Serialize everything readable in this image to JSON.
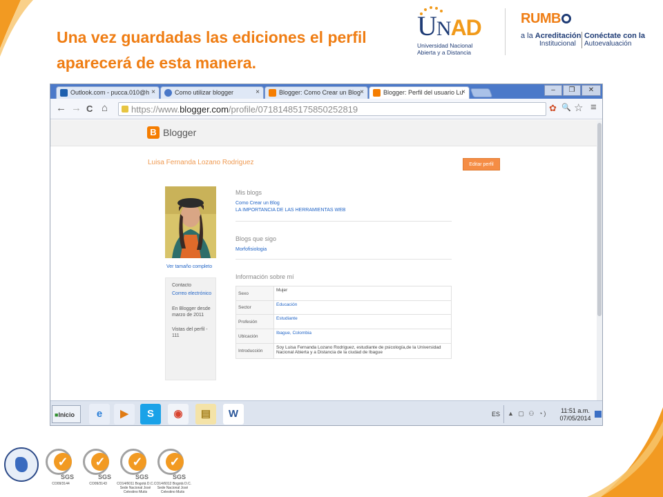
{
  "slide": {
    "title": "Una vez guardadas las ediciones el perfil aparecerá de esta manera."
  },
  "logos": {
    "unad_word_u": "U",
    "unad_word_n": "N",
    "unad_word_ad": "AD",
    "unad_sub1": "Universidad Nacional",
    "unad_sub2": "Abierta y a Distancia",
    "rumbo_word": "RUMB",
    "rumbo_sub1_a": "a la ",
    "rumbo_sub1_b": "Acreditación",
    "rumbo_sub2": "Institucional",
    "rumbo_c1": "Conéctate con la",
    "rumbo_c2": "Autoevaluación"
  },
  "browser": {
    "tabs": [
      {
        "label": "Outlook.com - pucca.010@h",
        "icon_color": "#1d5fae"
      },
      {
        "label": "Como utilizar blogger",
        "icon_color": "#4a78c8"
      },
      {
        "label": "Blogger: Como Crear un Blog",
        "icon_color": "#f57d00"
      },
      {
        "label": "Blogger: Perfil del usuario Lu",
        "icon_color": "#f57d00"
      }
    ],
    "tab_close": "×",
    "window_controls": {
      "minimize": "–",
      "maximize": "❐",
      "close": "✕"
    },
    "url_prefix": "https://www.",
    "url_domain": "blogger.com",
    "url_path": "/profile/07181485175850252819",
    "nav": {
      "back": "←",
      "forward": "→",
      "reload": "C",
      "home": "⌂"
    },
    "tools": {
      "extension": "✿",
      "zoom": "🔍",
      "star": "☆",
      "menu": "≡"
    }
  },
  "blogger": {
    "logo_letter": "B",
    "brand": "Blogger",
    "profile_name": "Luisa Fernanda Lozano Rodriguez",
    "edit_button": "Editar perfil",
    "full_size_link": "Ver tamaño completo",
    "sidebar": {
      "contact_label": "Contacto",
      "email_link": "Correo electrónico",
      "since_1": "En Blogger desde",
      "since_2": "marzo de 2011",
      "views_1": "Vistas del perfil -",
      "views_2": "111"
    },
    "my_blogs_title": "Mis blogs",
    "my_blogs": [
      "Como Crear un Blog",
      "LA IMPORTANCIA DE LAS HERRAMIENTAS WEB"
    ],
    "following_title": "Blogs que sigo",
    "following": [
      "Morfofisiologia"
    ],
    "about_title": "Información sobre mí",
    "about": [
      {
        "key": "Sexo",
        "value": "Mujer",
        "link": false
      },
      {
        "key": "Sector",
        "value": "Educación",
        "link": true
      },
      {
        "key": "Profesión",
        "value": "Estudiante",
        "link": true
      },
      {
        "key": "Ubicación",
        "value": "Ibague, Colombia",
        "link": true
      },
      {
        "key": "Introducción",
        "value": "Soy Luisa Fernanda Lozano Rodriguez, estudiante de psicología,de la Universidad Nacional Abierta y a Distancia de la ciudad de Ibague",
        "link": false
      }
    ]
  },
  "taskbar": {
    "start_label": "Inicio",
    "apps": [
      {
        "name": "ie",
        "glyph": "e",
        "bg": "#e9eef7",
        "color": "#2b7fd8"
      },
      {
        "name": "media",
        "glyph": "▶",
        "bg": "#e9eef7",
        "color": "#e07b13"
      },
      {
        "name": "skype",
        "glyph": "S",
        "bg": "#1aa2e8",
        "color": "#ffffff"
      },
      {
        "name": "chrome",
        "glyph": "◉",
        "bg": "#f1f4f9",
        "color": "#d8442f"
      },
      {
        "name": "explorer",
        "glyph": "▤",
        "bg": "#f4e3a8",
        "color": "#a37e1b"
      },
      {
        "name": "word",
        "glyph": "W",
        "bg": "#ffffff",
        "color": "#2a5699"
      }
    ],
    "language": "ES",
    "tray_icons": "▲ ▢ ⚇ ◔)",
    "time": "11:51 a.m.",
    "date": "07/05/2014"
  },
  "certs": [
    {
      "code": "CO09/3144"
    },
    {
      "code": "CO09/3143"
    },
    {
      "code": "CO14/6011 Bogotá D.C. Sede Nacional José Celestino Mutis"
    },
    {
      "code": "CO14/6012 Bogotá D.C. Sede Nacional José Celestino Mutis"
    }
  ],
  "cert_brand": "SGS"
}
